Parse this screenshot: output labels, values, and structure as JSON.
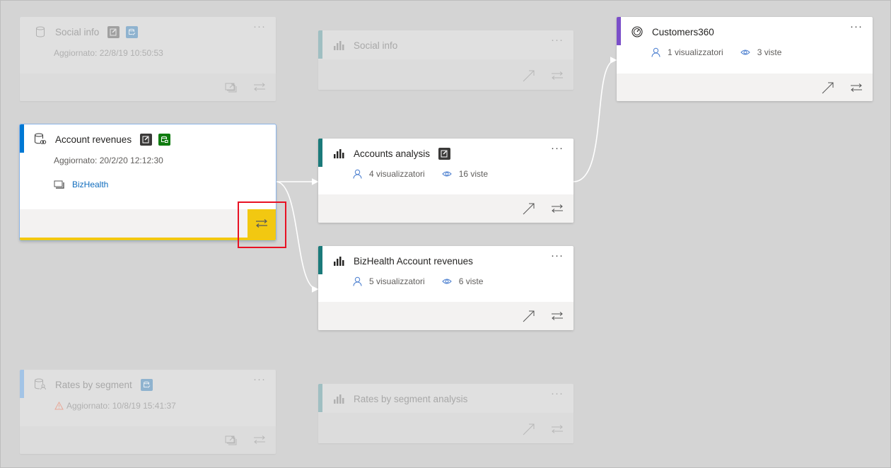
{
  "colors": {
    "background": "#d4d4d4",
    "dataset_accent": "#0078d4",
    "dataset_accent_dim": "#a3c4e6",
    "report_accent": "#1b7a7a",
    "report_accent_dim": "#9fbfc2",
    "dashboard_accent": "#7b4fc9",
    "highlight": "#f2c811",
    "annotation_box": "#e81123",
    "link_color": "#0f6cbd",
    "badge_dark": "#3b3a39",
    "badge_green": "#107c10",
    "badge_blue_dim": "#8fb3cf"
  },
  "cards": {
    "social_info_dataset": {
      "type": "dataset",
      "icon": "database-icon",
      "title": "Social info",
      "badges": [
        "endorsed-certified-icon",
        "dataset-verified-icon"
      ],
      "updated": "Aggiornato: 22/8/19 10:50:53",
      "actions": [
        "open-related-icon",
        "lineage-icon"
      ],
      "state": "dimmed"
    },
    "account_revenues_dataset": {
      "type": "dataset",
      "icon": "database-link-icon",
      "title": "Account revenues",
      "badges": [
        "endorsed-certified-icon",
        "dataset-promoted-icon"
      ],
      "updated": "Aggiornato: 20/2/20 12:12:30",
      "workspace": "BizHealth",
      "actions": [
        "lineage-icon"
      ],
      "state": "selected"
    },
    "rates_by_segment_dataset": {
      "type": "dataset",
      "icon": "database-user-icon",
      "title": "Rates by segment",
      "badges": [
        "dataset-verified-icon"
      ],
      "updated": "Aggiornato: 10/8/19 15:41:37",
      "warning": true,
      "actions": [
        "open-related-icon",
        "lineage-icon"
      ],
      "state": "dimmed"
    },
    "social_info_report": {
      "type": "report",
      "icon": "bar-chart-icon",
      "title": "Social info",
      "actions": [
        "open-icon",
        "lineage-icon"
      ],
      "state": "dimmed"
    },
    "accounts_analysis_report": {
      "type": "report",
      "icon": "bar-chart-icon",
      "title": "Accounts analysis",
      "badges": [
        "endorsed-certified-icon"
      ],
      "viewers": "4 visualizzatori",
      "views": "16 viste",
      "actions": [
        "open-icon",
        "lineage-icon"
      ],
      "state": "normal"
    },
    "bizhealth_account_revenues_report": {
      "type": "report",
      "icon": "bar-chart-icon",
      "title": "BizHealth Account revenues",
      "viewers": "5 visualizzatori",
      "views": "6 viste",
      "actions": [
        "open-icon",
        "lineage-icon"
      ],
      "state": "normal"
    },
    "rates_by_segment_analysis_report": {
      "type": "report",
      "icon": "bar-chart-icon",
      "title": "Rates by segment analysis",
      "actions": [
        "open-icon",
        "lineage-icon"
      ],
      "state": "dimmed"
    },
    "customers360_dashboard": {
      "type": "dashboard",
      "icon": "gauge-icon",
      "title": "Customers360",
      "viewers": "1 visualizzatori",
      "views": "3 viste",
      "actions": [
        "open-icon",
        "lineage-icon"
      ],
      "state": "normal"
    }
  },
  "more_label": "···"
}
